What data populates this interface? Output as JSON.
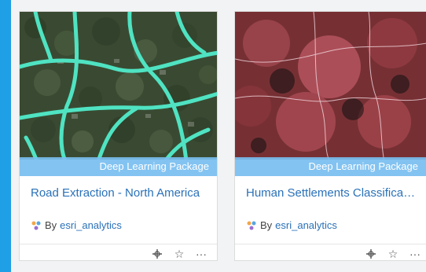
{
  "cards": [
    {
      "badge": "Deep Learning Package",
      "title": "Road Extraction - North America",
      "by_label": "By",
      "owner": "esri_analytics",
      "thumb_icon": "aerial-roads-image",
      "owner_icon": "package-icon"
    },
    {
      "badge": "Deep Learning Package",
      "title": "Human Settlements Classifica…",
      "by_label": "By",
      "owner": "esri_analytics",
      "thumb_icon": "satellite-settlements-image",
      "owner_icon": "package-icon"
    }
  ],
  "actions": {
    "add_icon": "add-to-map-icon",
    "favorite_icon": "star-outline-icon",
    "favorite_glyph": "☆",
    "more_icon": "more-options-icon",
    "more_glyph": "···"
  },
  "colors": {
    "background": "#1fa0e6",
    "canvas": "#f2f3f4",
    "link": "#2a71b8",
    "badge_bg": "#78bef0",
    "road_overlay": "#4fe3c2"
  }
}
